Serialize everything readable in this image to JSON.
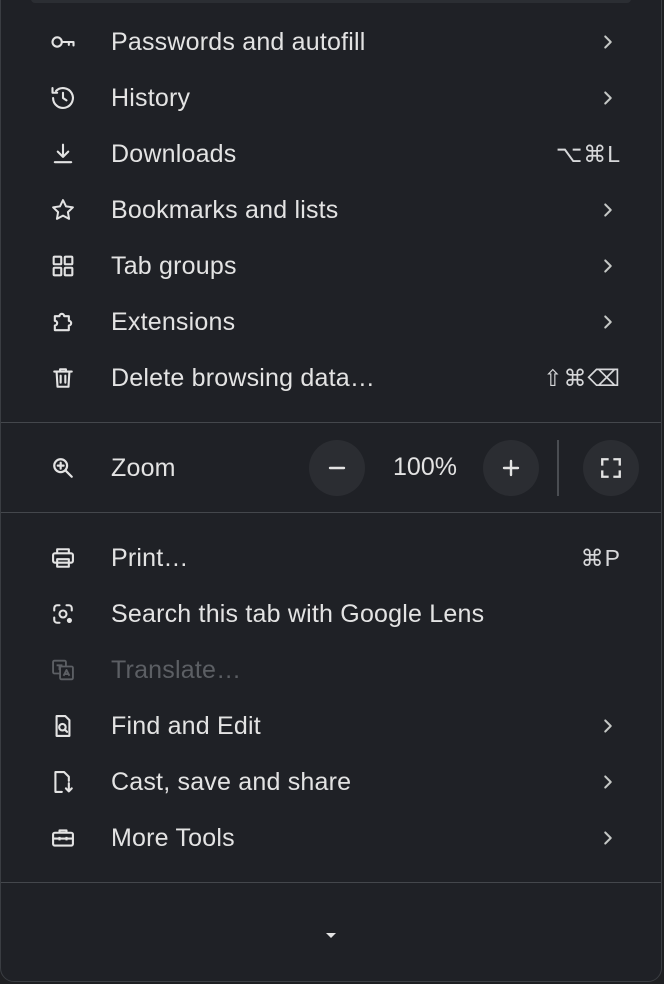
{
  "menu": {
    "items_top": [
      {
        "label": "Passwords and autofill",
        "icon": "key-icon",
        "submenu": true
      },
      {
        "label": "History",
        "icon": "history-icon",
        "submenu": true
      },
      {
        "label": "Downloads",
        "icon": "download-icon",
        "shortcut": "⌥⌘L"
      },
      {
        "label": "Bookmarks and lists",
        "icon": "star-icon",
        "submenu": true
      },
      {
        "label": "Tab groups",
        "icon": "tab-groups-icon",
        "submenu": true
      },
      {
        "label": "Extensions",
        "icon": "puzzle-icon",
        "submenu": true
      },
      {
        "label": "Delete browsing data…",
        "icon": "trash-icon",
        "shortcut": "⇧⌘⌫"
      }
    ],
    "zoom": {
      "label": "Zoom",
      "value": "100%",
      "minus_label": "−",
      "plus_label": "+"
    },
    "items_bottom": [
      {
        "label": "Print…",
        "icon": "printer-icon",
        "shortcut": "⌘P"
      },
      {
        "label": "Search this tab with Google Lens",
        "icon": "google-lens-icon"
      },
      {
        "label": "Translate…",
        "icon": "translate-icon",
        "disabled": true
      },
      {
        "label": "Find and Edit",
        "icon": "find-page-icon",
        "submenu": true
      },
      {
        "label": "Cast, save and share",
        "icon": "cast-save-share-icon",
        "submenu": true
      },
      {
        "label": "More Tools",
        "icon": "toolbox-icon",
        "submenu": true
      }
    ]
  },
  "colors": {
    "background": "#1f2126",
    "text": "#e3e3e3",
    "disabled_text": "#5c5f64",
    "divider": "#44474c",
    "button_bg": "#2b2d32"
  }
}
